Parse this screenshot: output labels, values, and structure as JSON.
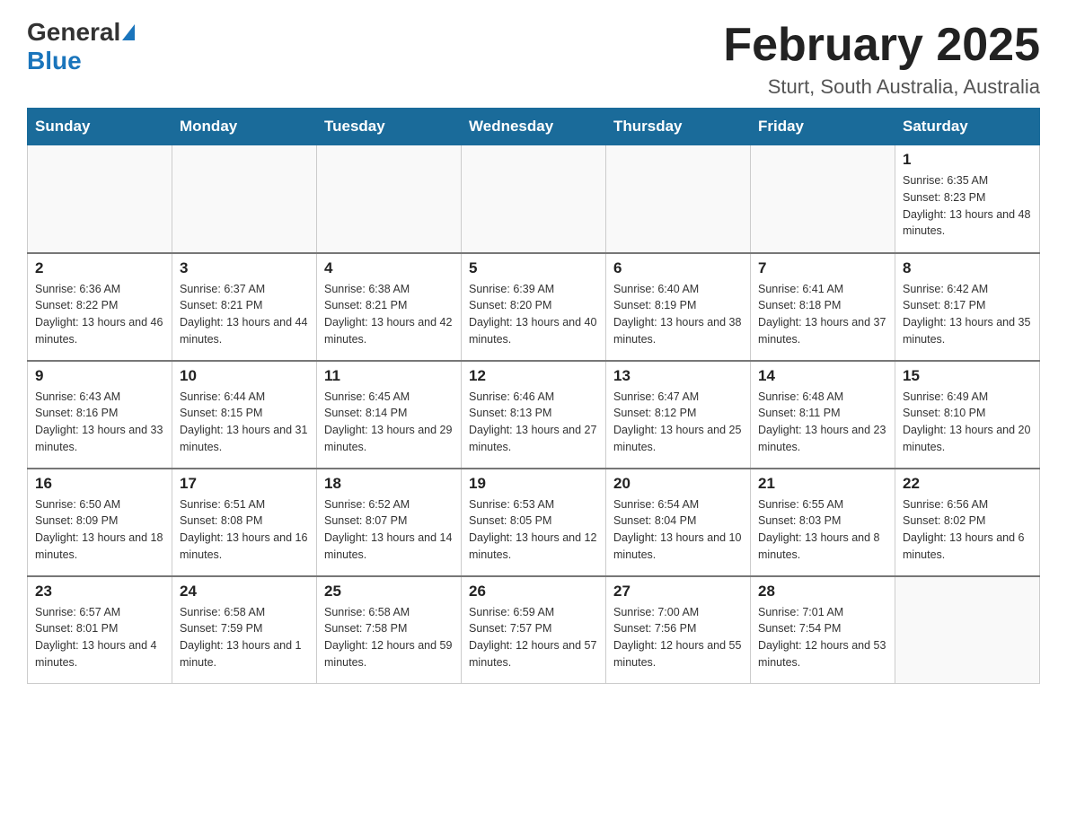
{
  "header": {
    "logo_general": "General",
    "logo_blue": "Blue",
    "month_title": "February 2025",
    "location": "Sturt, South Australia, Australia"
  },
  "weekdays": [
    "Sunday",
    "Monday",
    "Tuesday",
    "Wednesday",
    "Thursday",
    "Friday",
    "Saturday"
  ],
  "weeks": [
    [
      {
        "day": "",
        "info": ""
      },
      {
        "day": "",
        "info": ""
      },
      {
        "day": "",
        "info": ""
      },
      {
        "day": "",
        "info": ""
      },
      {
        "day": "",
        "info": ""
      },
      {
        "day": "",
        "info": ""
      },
      {
        "day": "1",
        "info": "Sunrise: 6:35 AM\nSunset: 8:23 PM\nDaylight: 13 hours and 48 minutes."
      }
    ],
    [
      {
        "day": "2",
        "info": "Sunrise: 6:36 AM\nSunset: 8:22 PM\nDaylight: 13 hours and 46 minutes."
      },
      {
        "day": "3",
        "info": "Sunrise: 6:37 AM\nSunset: 8:21 PM\nDaylight: 13 hours and 44 minutes."
      },
      {
        "day": "4",
        "info": "Sunrise: 6:38 AM\nSunset: 8:21 PM\nDaylight: 13 hours and 42 minutes."
      },
      {
        "day": "5",
        "info": "Sunrise: 6:39 AM\nSunset: 8:20 PM\nDaylight: 13 hours and 40 minutes."
      },
      {
        "day": "6",
        "info": "Sunrise: 6:40 AM\nSunset: 8:19 PM\nDaylight: 13 hours and 38 minutes."
      },
      {
        "day": "7",
        "info": "Sunrise: 6:41 AM\nSunset: 8:18 PM\nDaylight: 13 hours and 37 minutes."
      },
      {
        "day": "8",
        "info": "Sunrise: 6:42 AM\nSunset: 8:17 PM\nDaylight: 13 hours and 35 minutes."
      }
    ],
    [
      {
        "day": "9",
        "info": "Sunrise: 6:43 AM\nSunset: 8:16 PM\nDaylight: 13 hours and 33 minutes."
      },
      {
        "day": "10",
        "info": "Sunrise: 6:44 AM\nSunset: 8:15 PM\nDaylight: 13 hours and 31 minutes."
      },
      {
        "day": "11",
        "info": "Sunrise: 6:45 AM\nSunset: 8:14 PM\nDaylight: 13 hours and 29 minutes."
      },
      {
        "day": "12",
        "info": "Sunrise: 6:46 AM\nSunset: 8:13 PM\nDaylight: 13 hours and 27 minutes."
      },
      {
        "day": "13",
        "info": "Sunrise: 6:47 AM\nSunset: 8:12 PM\nDaylight: 13 hours and 25 minutes."
      },
      {
        "day": "14",
        "info": "Sunrise: 6:48 AM\nSunset: 8:11 PM\nDaylight: 13 hours and 23 minutes."
      },
      {
        "day": "15",
        "info": "Sunrise: 6:49 AM\nSunset: 8:10 PM\nDaylight: 13 hours and 20 minutes."
      }
    ],
    [
      {
        "day": "16",
        "info": "Sunrise: 6:50 AM\nSunset: 8:09 PM\nDaylight: 13 hours and 18 minutes."
      },
      {
        "day": "17",
        "info": "Sunrise: 6:51 AM\nSunset: 8:08 PM\nDaylight: 13 hours and 16 minutes."
      },
      {
        "day": "18",
        "info": "Sunrise: 6:52 AM\nSunset: 8:07 PM\nDaylight: 13 hours and 14 minutes."
      },
      {
        "day": "19",
        "info": "Sunrise: 6:53 AM\nSunset: 8:05 PM\nDaylight: 13 hours and 12 minutes."
      },
      {
        "day": "20",
        "info": "Sunrise: 6:54 AM\nSunset: 8:04 PM\nDaylight: 13 hours and 10 minutes."
      },
      {
        "day": "21",
        "info": "Sunrise: 6:55 AM\nSunset: 8:03 PM\nDaylight: 13 hours and 8 minutes."
      },
      {
        "day": "22",
        "info": "Sunrise: 6:56 AM\nSunset: 8:02 PM\nDaylight: 13 hours and 6 minutes."
      }
    ],
    [
      {
        "day": "23",
        "info": "Sunrise: 6:57 AM\nSunset: 8:01 PM\nDaylight: 13 hours and 4 minutes."
      },
      {
        "day": "24",
        "info": "Sunrise: 6:58 AM\nSunset: 7:59 PM\nDaylight: 13 hours and 1 minute."
      },
      {
        "day": "25",
        "info": "Sunrise: 6:58 AM\nSunset: 7:58 PM\nDaylight: 12 hours and 59 minutes."
      },
      {
        "day": "26",
        "info": "Sunrise: 6:59 AM\nSunset: 7:57 PM\nDaylight: 12 hours and 57 minutes."
      },
      {
        "day": "27",
        "info": "Sunrise: 7:00 AM\nSunset: 7:56 PM\nDaylight: 12 hours and 55 minutes."
      },
      {
        "day": "28",
        "info": "Sunrise: 7:01 AM\nSunset: 7:54 PM\nDaylight: 12 hours and 53 minutes."
      },
      {
        "day": "",
        "info": ""
      }
    ]
  ]
}
